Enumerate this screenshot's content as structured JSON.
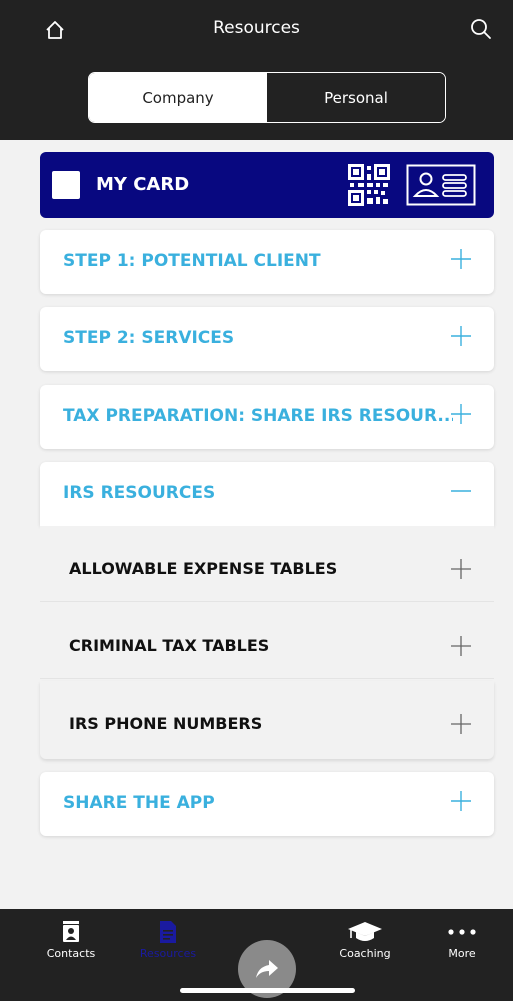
{
  "header": {
    "title": "Resources",
    "home_icon": "home-icon",
    "search_icon": "search-icon"
  },
  "segments": {
    "company": "Company",
    "personal": "Personal",
    "selected": "Company"
  },
  "my_card": {
    "label": "MY CARD",
    "icons": [
      "qr-code-icon",
      "id-card-icon"
    ]
  },
  "sections": [
    {
      "title": "STEP 1: POTENTIAL CLIENT",
      "expanded": false
    },
    {
      "title": "STEP 2: SERVICES",
      "expanded": false
    },
    {
      "title": "TAX PREPARATION: SHARE IRS RESOUR...",
      "expanded": false
    },
    {
      "title": "IRS RESOURCES",
      "expanded": true,
      "items": [
        {
          "title": "ALLOWABLE EXPENSE TABLES"
        },
        {
          "title": "CRIMINAL TAX TABLES"
        },
        {
          "title": "IRS PHONE NUMBERS"
        }
      ]
    },
    {
      "title": "SHARE THE APP",
      "expanded": false
    }
  ],
  "tabbar": {
    "items": [
      {
        "label": "Contacts",
        "icon": "contacts-icon",
        "active": false
      },
      {
        "label": "Resources",
        "icon": "document-icon",
        "active": true
      },
      {
        "label": "Coaching",
        "icon": "graduation-cap-icon",
        "active": false
      },
      {
        "label": "More",
        "icon": "more-dots-icon",
        "active": false
      }
    ],
    "fab_icon": "share-arrow-icon"
  },
  "colors": {
    "header_bg": "#222222",
    "my_card_bg": "#080880",
    "section_title": "#3ab0de",
    "tab_active": "#1a1aa0",
    "tab_inactive": "#ffffff"
  }
}
